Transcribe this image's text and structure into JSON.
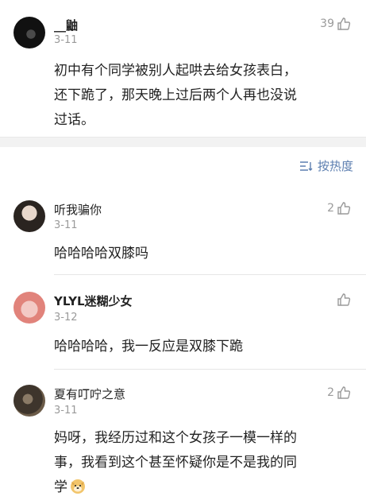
{
  "main_comment": {
    "username": "__鼬",
    "date": "3-11",
    "likes": "39",
    "text_lines": [
      "初中有个同学被别人起哄去给女孩表白，",
      "还下跪了，那天晚上过后两个人再也没说",
      "过话。"
    ]
  },
  "sort": {
    "label": "按热度"
  },
  "replies": [
    {
      "username": "听我骗你",
      "date": "3-11",
      "likes": "2",
      "text": "哈哈哈哈双膝吗"
    },
    {
      "username": "YLYL迷糊少女",
      "date": "3-12",
      "likes": "",
      "text": "哈哈哈哈，我一反应是双膝下跪"
    },
    {
      "username": "夏有叮咛之意",
      "date": "3-11",
      "likes": "2",
      "text_lines": [
        "妈呀，我经历过和这个女孩子一模一样的",
        "事，我看到这个甚至怀疑你是不是我的同",
        "学"
      ],
      "emoji": "doge-emoji"
    }
  ],
  "colors": {
    "link_blue": "#5d7fb0",
    "meta_gray": "#9a9a9a",
    "band_gray": "#f2f2f2"
  }
}
